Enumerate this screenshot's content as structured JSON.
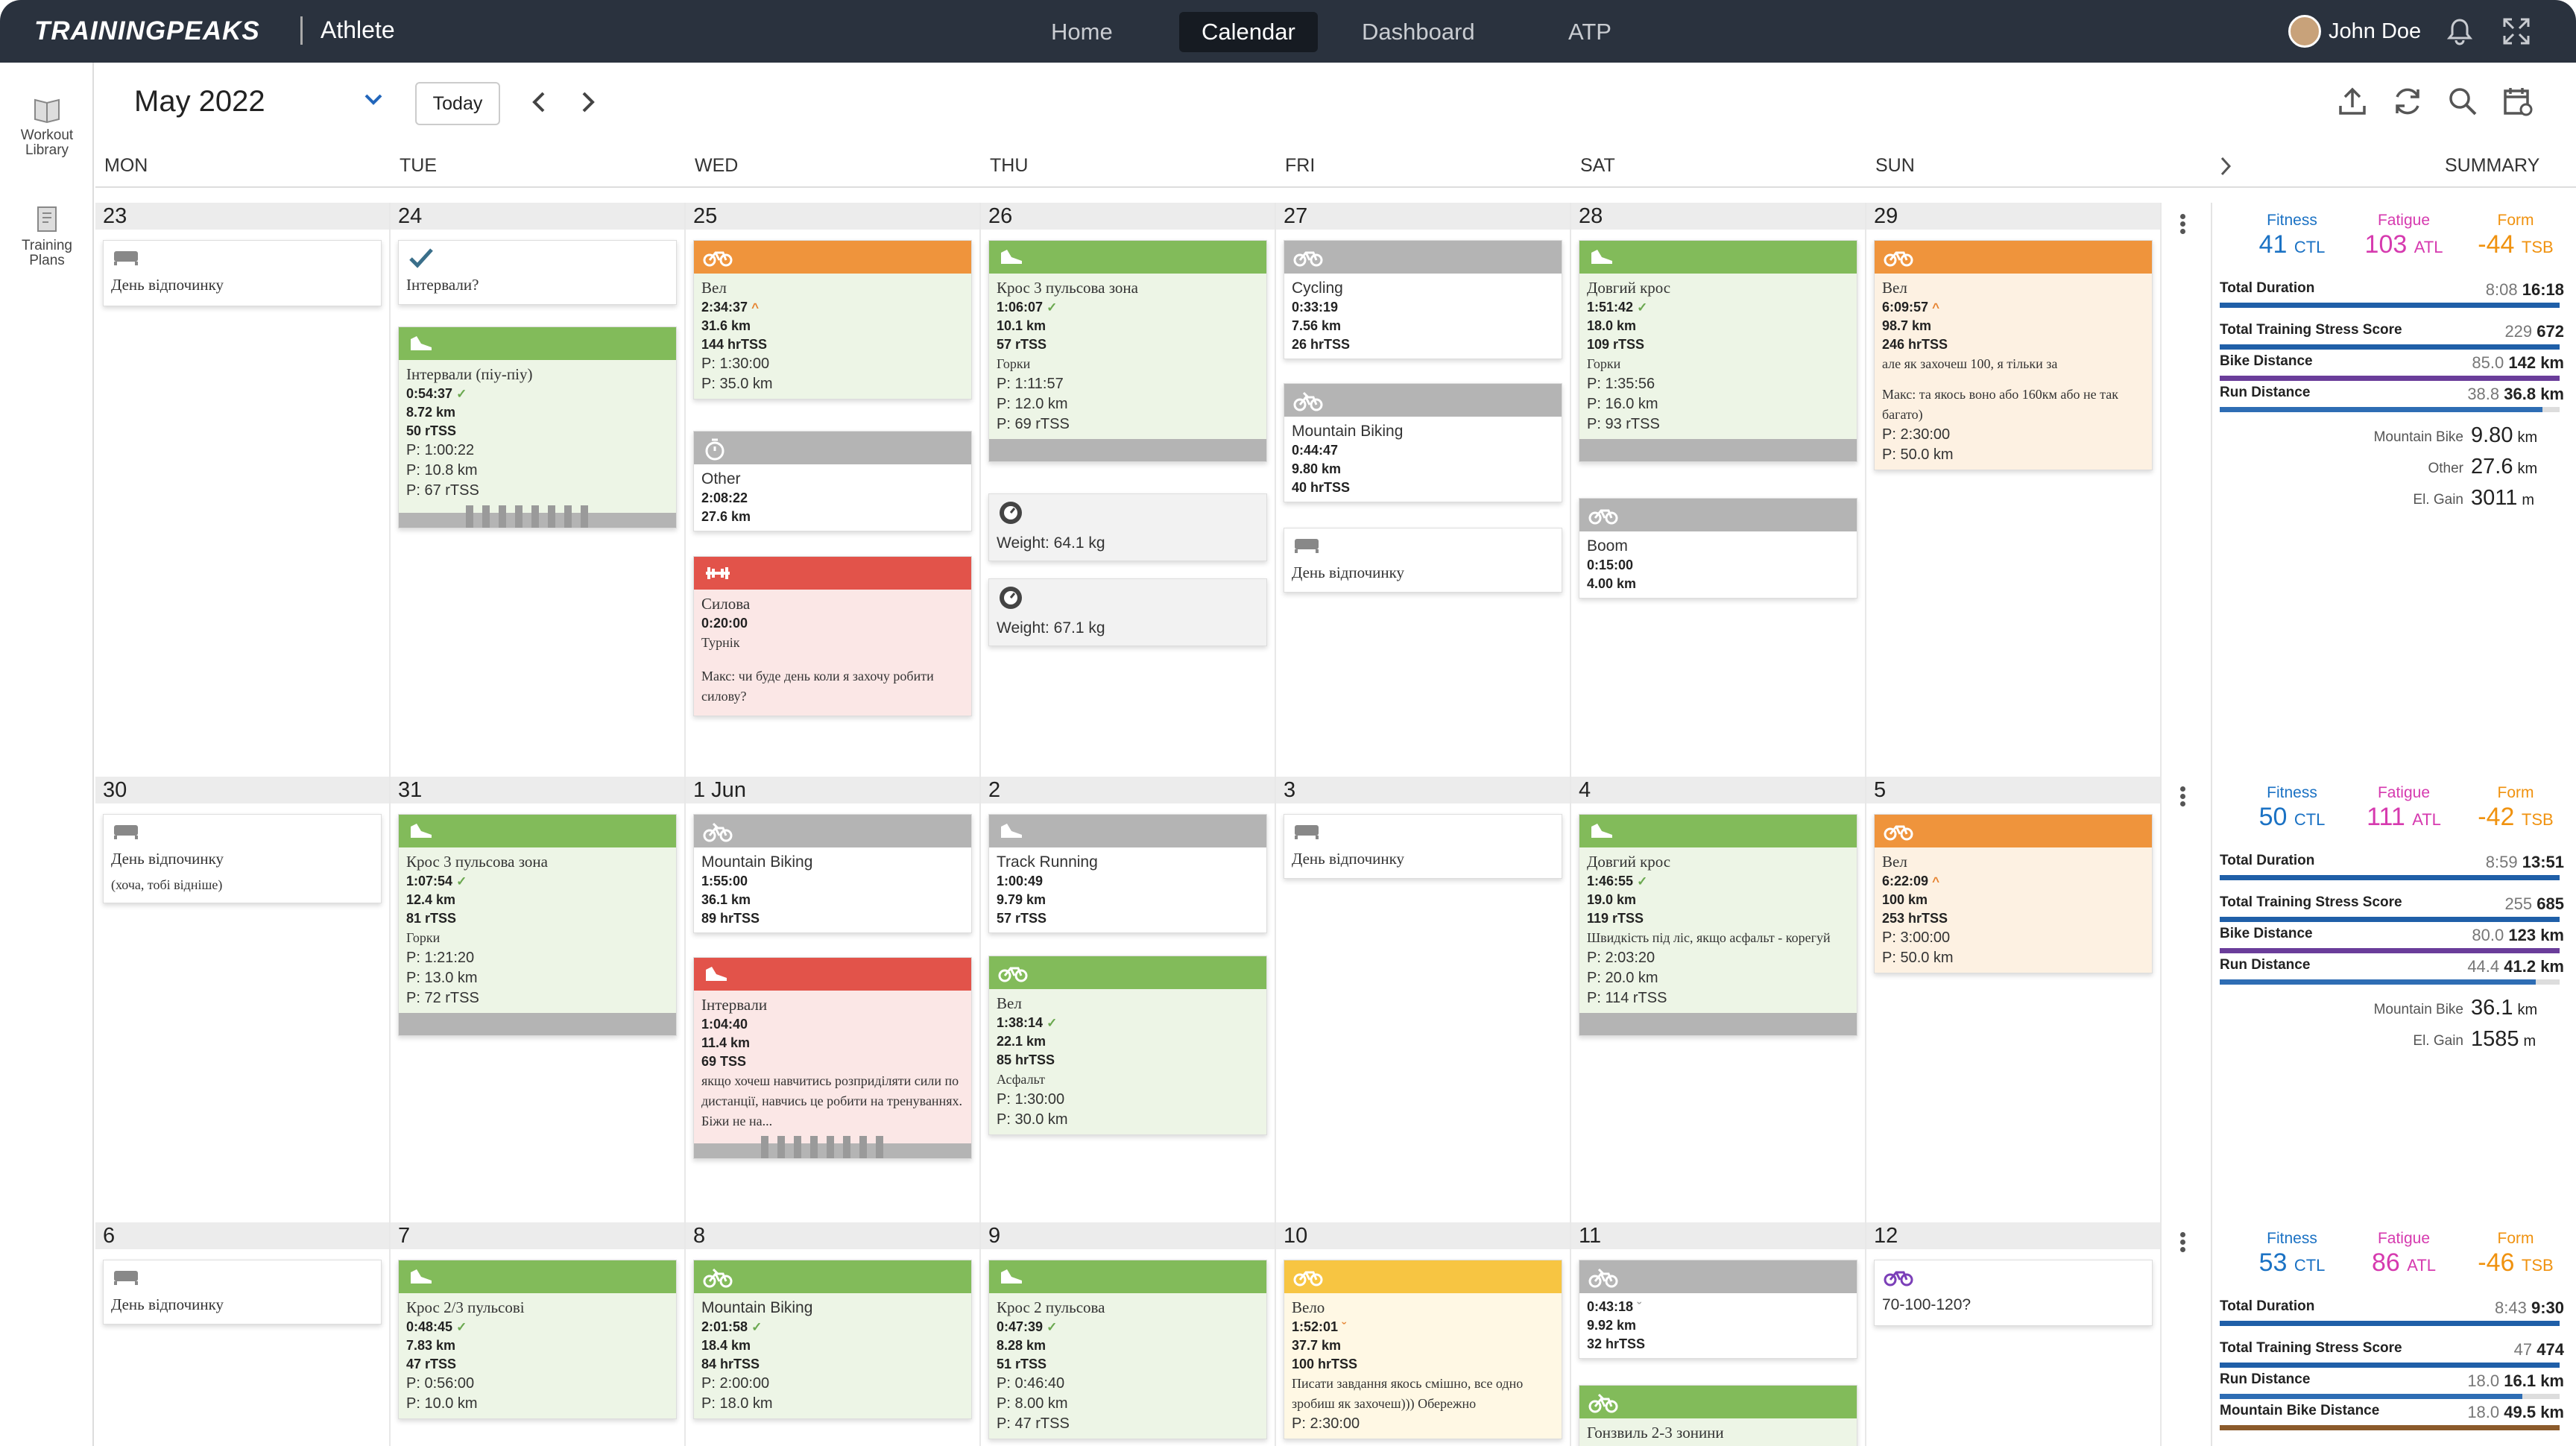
{
  "app": {
    "brand": "TRAININGPEAKS",
    "product": "Athlete"
  },
  "nav": [
    "Home",
    "Calendar",
    "Dashboard",
    "ATP"
  ],
  "nav_active": "Calendar",
  "user": {
    "name": "John Doe"
  },
  "sidebar": [
    {
      "label": "Workout Library",
      "icon": "book-icon"
    },
    {
      "label": "Training Plans",
      "icon": "notebook-icon"
    }
  ],
  "header": {
    "month": "May 2022",
    "today": "Today"
  },
  "days": [
    "MON",
    "TUE",
    "WED",
    "THU",
    "FRI",
    "SAT",
    "SUN"
  ],
  "summary_title": "SUMMARY",
  "colors": {
    "run": "#82bb5a",
    "bike_over": "#ef943c",
    "strength": "#e2534a",
    "planned": "#b4b4b4",
    "partial": "#f7c542",
    "fitness": "#1b72c4",
    "fatigue": "#d63aaf",
    "form": "#f0920f"
  },
  "weeks": [
    {
      "dates": [
        "23",
        "24",
        "25",
        "26",
        "27",
        "28",
        "29"
      ],
      "summary": {
        "fitness": "41",
        "fatigue": "103",
        "form": "-44",
        "rows": [
          {
            "label": "Total Duration",
            "planned": "8:08",
            "completed": "16:18",
            "pct": 1.0,
            "color": "#1f5fa8"
          },
          {
            "label": "Total Training Stress Score",
            "planned": "229",
            "completed": "672",
            "pct": 1.0,
            "color": "#1f5fa8"
          },
          {
            "label": "Bike Distance",
            "planned": "85.0",
            "completed": "142 km",
            "pct": 1.0,
            "color": "#6a3d9a"
          },
          {
            "label": "Run Distance",
            "planned": "38.8",
            "completed": "36.8 km",
            "pct": 0.95,
            "color": "#2e6db4"
          }
        ],
        "extras": [
          {
            "label": "Mountain Bike",
            "value": "9.80",
            "unit": "km"
          },
          {
            "label": "Other",
            "value": "27.6",
            "unit": "km"
          },
          {
            "label": "El. Gain",
            "value": "3011",
            "unit": "m"
          }
        ]
      }
    },
    {
      "dates": [
        "30",
        "31",
        "1 Jun",
        "2",
        "3",
        "4",
        "5"
      ],
      "summary": {
        "fitness": "50",
        "fatigue": "111",
        "form": "-42",
        "rows": [
          {
            "label": "Total Duration",
            "planned": "8:59",
            "completed": "13:51",
            "pct": 1.0,
            "color": "#1f5fa8"
          },
          {
            "label": "Total Training Stress Score",
            "planned": "255",
            "completed": "685",
            "pct": 1.0,
            "color": "#1f5fa8"
          },
          {
            "label": "Bike Distance",
            "planned": "80.0",
            "completed": "123 km",
            "pct": 1.0,
            "color": "#6a3d9a"
          },
          {
            "label": "Run Distance",
            "planned": "44.4",
            "completed": "41.2 km",
            "pct": 0.93,
            "color": "#2e6db4"
          }
        ],
        "extras": [
          {
            "label": "Mountain Bike",
            "value": "36.1",
            "unit": "km"
          },
          {
            "label": "El. Gain",
            "value": "1585",
            "unit": "m"
          }
        ]
      }
    },
    {
      "dates": [
        "6",
        "7",
        "8",
        "9",
        "10",
        "11",
        "12"
      ],
      "summary": {
        "fitness": "53",
        "fatigue": "86",
        "form": "-46",
        "rows": [
          {
            "label": "Total Duration",
            "planned": "8:43",
            "completed": "9:30",
            "pct": 1.0,
            "color": "#1f5fa8"
          },
          {
            "label": "Total Training Stress Score",
            "planned": "47",
            "completed": "474",
            "pct": 1.0,
            "color": "#1f5fa8"
          },
          {
            "label": "Run Distance",
            "planned": "18.0",
            "completed": "16.1 km",
            "pct": 0.89,
            "color": "#2e6db4"
          },
          {
            "label": "Mountain Bike Distance",
            "planned": "18.0",
            "completed": "49.5 km",
            "pct": 1.0,
            "color": "#8b5a2b"
          }
        ],
        "extras": []
      }
    }
  ],
  "summary_labels": {
    "fitness": "Fitness",
    "fatigue": "Fatigue",
    "form": "Form",
    "ctl": "CTL",
    "atl": "ATL",
    "tsb": "TSB"
  },
  "cards": {
    "w1": {
      "mon": {
        "t": "День відпочинку"
      },
      "tue1": {
        "t": "Інтервали?"
      },
      "tue2": {
        "t": "Інтервали (піу-піу)",
        "d": "0:54:37",
        "dist": "8.72 km",
        "tss": "50 rTSS",
        "p1": "P: 1:00:22",
        "p2": "P: 10.8 km",
        "p3": "P: 67 rTSS"
      },
      "wed1": {
        "t": "Вел",
        "d": "2:34:37",
        "dist": "31.6 km",
        "tss": "144 hrTSS",
        "p1": "P: 1:30:00",
        "p2": "P: 35.0 km"
      },
      "wed2": {
        "t": "Other",
        "d": "2:08:22",
        "dist": "27.6 km"
      },
      "wed3": {
        "t": "Силова",
        "d": "0:20:00",
        "n1": "Турнік",
        "n2": "Макс: чи буде день коли я захочу робити силову?"
      },
      "thu1": {
        "t": "Крос 3 пульсова зона",
        "d": "1:06:07",
        "dist": "10.1 km",
        "tss": "57 rTSS",
        "n1": "Горки",
        "p1": "P: 1:11:57",
        "p2": "P: 12.0 km",
        "p3": "P: 69 rTSS"
      },
      "thu2": {
        "t": "Weight: 64.1 kg"
      },
      "thu3": {
        "t": "Weight: 67.1 kg"
      },
      "fri1": {
        "t": "Cycling",
        "d": "0:33:19",
        "dist": "7.56 km",
        "tss": "26 hrTSS"
      },
      "fri2": {
        "t": "Mountain Biking",
        "d": "0:44:47",
        "dist": "9.80 km",
        "tss": "40 hrTSS"
      },
      "fri3": {
        "t": "День відпочинку"
      },
      "sat1": {
        "t": "Довгий крос",
        "d": "1:51:42",
        "dist": "18.0 km",
        "tss": "109 rTSS",
        "n1": "Горки",
        "p1": "P: 1:35:56",
        "p2": "P: 16.0 km",
        "p3": "P: 93 rTSS"
      },
      "sat2": {
        "t": "Boom",
        "d": "0:15:00",
        "dist": "4.00 km"
      },
      "sun1": {
        "t": "Вел",
        "d": "6:09:57",
        "dist": "98.7 km",
        "tss": "246 hrTSS",
        "n1": "але як захочеш 100, я тільки за",
        "n2": "Макс: та якось воно або 160км або не так багато)",
        "p1": "P: 2:30:00",
        "p2": "P: 50.0 km"
      }
    },
    "w2": {
      "mon": {
        "t": "День відпочинку",
        "n1": "(хоча, тобі відніше)"
      },
      "tue1": {
        "t": "Крос 3 пульсова зона",
        "d": "1:07:54",
        "dist": "12.4 km",
        "tss": "81 rTSS",
        "n1": "Горки",
        "p1": "P: 1:21:20",
        "p2": "P: 13.0 km",
        "p3": "P: 72 rTSS"
      },
      "wed1": {
        "t": "Mountain Biking",
        "d": "1:55:00",
        "dist": "36.1 km",
        "tss": "89 hrTSS"
      },
      "wed2": {
        "t": "Інтервали",
        "d": "1:04:40",
        "dist": "11.4 km",
        "tss": "69 TSS",
        "n1": "якщо хочеш навчитись розприділяти сили по дистанції, навчись це робити на тренуваннях. Біжи не на..."
      },
      "thu1": {
        "t": "Track Running",
        "d": "1:00:49",
        "dist": "9.79 km",
        "tss": "57 rTSS"
      },
      "thu2": {
        "t": "Вел",
        "d": "1:38:14",
        "dist": "22.1 km",
        "tss": "85 hrTSS",
        "n1": "Асфальт",
        "p1": "P: 1:30:00",
        "p2": "P: 30.0 km"
      },
      "fri1": {
        "t": "День відпочинку"
      },
      "sat1": {
        "t": "Довгий крос",
        "d": "1:46:55",
        "dist": "19.0 km",
        "tss": "119 rTSS",
        "n1": "Швидкість під ліс, якщо асфальт - корегуй",
        "p1": "P: 2:03:20",
        "p2": "P: 20.0 km",
        "p3": "P: 114 rTSS"
      },
      "sun1": {
        "t": "Вел",
        "d": "6:22:09",
        "dist": "100 km",
        "tss": "253 hrTSS",
        "p1": "P: 3:00:00",
        "p2": "P: 50.0 km"
      }
    },
    "w3": {
      "mon": {
        "t": "День відпочинку"
      },
      "tue1": {
        "t": "Крос 2/3 пульсові",
        "d": "0:48:45",
        "dist": "7.83 km",
        "tss": "47 rTSS",
        "p1": "P: 0:56:00",
        "p2": "P: 10.0 km"
      },
      "wed1": {
        "t": "Mountain Biking",
        "d": "2:01:58",
        "dist": "18.4 km",
        "tss": "84 hrTSS",
        "p1": "P: 2:00:00",
        "p2": "P: 18.0 km"
      },
      "thu1": {
        "t": "Крос 2 пульсова",
        "d": "0:47:39",
        "dist": "8.28 km",
        "tss": "51 rTSS",
        "p1": "P: 0:46:40",
        "p2": "P: 8.00 km",
        "p3": "P: 47 rTSS"
      },
      "fri1": {
        "t": "Вело",
        "d": "1:52:01",
        "dist": "37.7 km",
        "tss": "100 hrTSS",
        "n1": "Писати завдання якось смішно, все одно зробиш як захочеш))) Обережно",
        "p1": "P: 2:30:00"
      },
      "sat1": {
        "d": "0:43:18",
        "dist": "9.92 km",
        "tss": "32 hrTSS"
      },
      "sat2": {
        "t": "Гонзвиль 2-3 зонини"
      },
      "sun1": {
        "t": "70-100-120?"
      }
    }
  }
}
